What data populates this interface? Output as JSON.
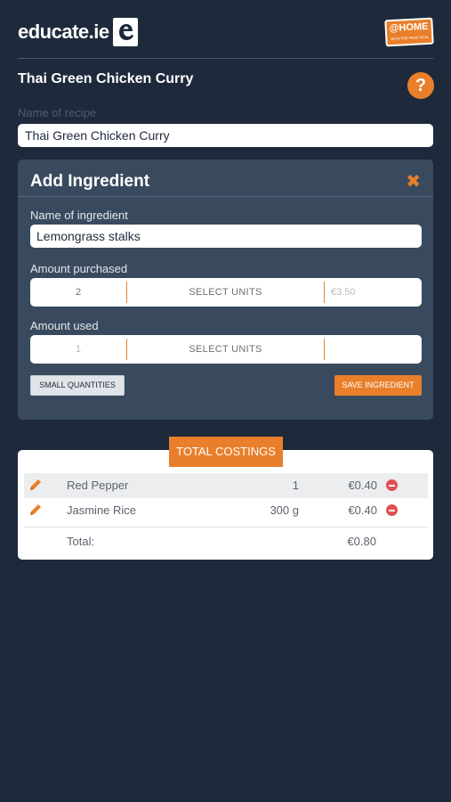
{
  "header": {
    "logo_text": "educate.ie",
    "badge_main": "@HOME",
    "badge_sub": "WITH THE PRACTICAL"
  },
  "recipe": {
    "title": "Thai Green Chicken Curry",
    "name_label": "Name of recipe",
    "name_value": "Thai Green Chicken Curry",
    "help_icon": "question-mark-icon"
  },
  "add_ingredient": {
    "title": "Add Ingredient",
    "close_icon": "close-icon",
    "ingredient_label": "Name of ingredient",
    "ingredient_value": "Lemongrass stalks",
    "purchased_label": "Amount purchased",
    "purchased_qty": "2",
    "purchased_units": "SELECT UNITS",
    "purchased_price": "€3.50",
    "used_label": "Amount used",
    "used_qty": "1",
    "used_units": "SELECT UNITS",
    "small_quantities_label": "SMALL QUANTITIES",
    "save_label": "SAVE INGREDIENT"
  },
  "costings": {
    "tab_label": "TOTAL COSTINGS",
    "rows": [
      {
        "name": "Red Pepper",
        "qty": "1",
        "price": "€0.40"
      },
      {
        "name": "Jasmine Rice",
        "qty": "300 g",
        "price": "€0.40"
      }
    ],
    "total_label": "Total:",
    "total_value": "€0.80"
  },
  "colors": {
    "background": "#1e2a3c",
    "panel": "#3a4a5e",
    "accent": "#e97f2a",
    "remove": "#e05252"
  }
}
